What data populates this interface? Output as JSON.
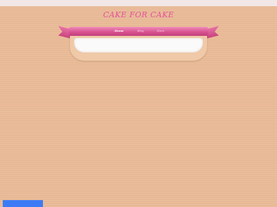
{
  "header": {
    "site_title": "CAKE FOR CAKE"
  },
  "nav": {
    "items": [
      {
        "label": "Home",
        "active": true
      },
      {
        "label": "Blog",
        "active": false
      },
      {
        "label": "Store",
        "active": false
      }
    ]
  },
  "colors": {
    "background": "#ebbc98",
    "title": "#e64f9b",
    "ribbon": "#d74f8f",
    "panel": "#fbfafa",
    "bottom_button": "#3c7bf5"
  },
  "icons": {
    "ribbon_tails": "ribbon-tail-icon"
  }
}
